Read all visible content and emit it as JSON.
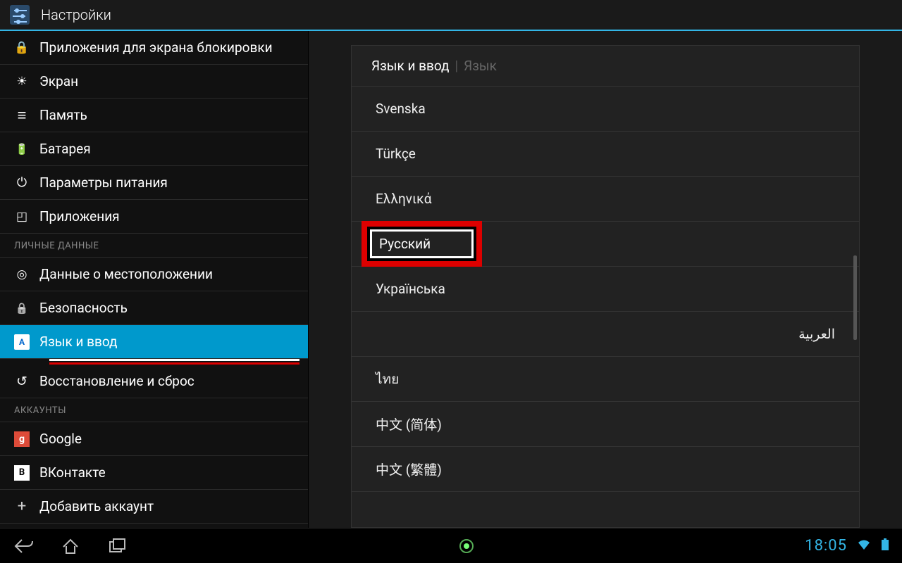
{
  "app_title": "Настройки",
  "sidebar": {
    "items": [
      {
        "icon": "lock-icon",
        "label": "Приложения для экрана блокировки"
      },
      {
        "icon": "display-icon",
        "label": "Экран"
      },
      {
        "icon": "storage-icon",
        "label": "Память"
      },
      {
        "icon": "battery-icon",
        "label": "Батарея"
      },
      {
        "icon": "power-icon",
        "label": "Параметры питания"
      },
      {
        "icon": "apps-icon",
        "label": "Приложения"
      }
    ],
    "section_personal": "ЛИЧНЫЕ ДАННЫЕ",
    "personal_items": [
      {
        "icon": "location-icon",
        "label": "Данные о местоположении"
      },
      {
        "icon": "security-icon",
        "label": "Безопасность"
      },
      {
        "icon": "language-icon",
        "label": "Язык и ввод",
        "selected": true,
        "glyph": "A"
      },
      {
        "icon": "reset-icon",
        "label": "Восстановление и сброс"
      }
    ],
    "section_accounts": "АККАУНТЫ",
    "account_items": [
      {
        "icon": "google-icon",
        "label": "Google",
        "glyph": "g"
      },
      {
        "icon": "vk-icon",
        "label": "ВКонтакте",
        "glyph": "В"
      },
      {
        "icon": "add-icon",
        "label": "Добавить аккаунт"
      }
    ]
  },
  "panel": {
    "breadcrumb": [
      "Язык и ввод",
      "Язык"
    ],
    "languages": [
      {
        "label": "Svenska"
      },
      {
        "label": "Türkçe"
      },
      {
        "label": "Ελληνικά"
      },
      {
        "label": "Русский",
        "highlighted": true
      },
      {
        "label": "Українська"
      },
      {
        "label": "العربية",
        "rtl": true
      },
      {
        "label": "ไทย"
      },
      {
        "label": "中文 (简体)"
      },
      {
        "label": "中文 (繁體)"
      }
    ]
  },
  "navbar": {
    "clock": "18:05"
  },
  "colors": {
    "accent": "#33b5e5",
    "selected": "#0099cc",
    "highlight_border": "#d00"
  }
}
